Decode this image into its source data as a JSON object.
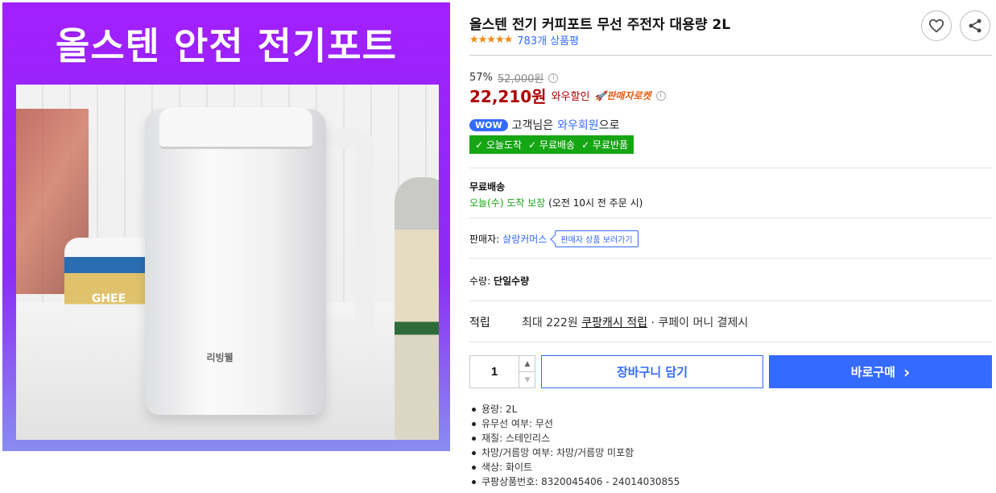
{
  "hero": {
    "title": "올스텐 안전 전기포트",
    "kettle_brand": "리빙웰",
    "jar_label": "GHEE"
  },
  "product": {
    "title": "올스텐 전기 커피포트 무선 주전자 대용량 2L",
    "stars": "★★★★★",
    "review_count": "783개 상품평",
    "rating_value": 4.5
  },
  "price": {
    "discount_rate": "57%",
    "original": "52,000원",
    "sale": "22,210원",
    "wow_label": "와우할인",
    "rocket_label": "판매자로켓"
  },
  "wow": {
    "badge": "WOW",
    "text_before": "고객님은",
    "member": "와우회원",
    "text_after": "으로",
    "benefits": [
      "✓ 오늘도착",
      "✓ 무료배송",
      "✓ 무료반품"
    ]
  },
  "shipping": {
    "label": "무료배송",
    "arrival": "오늘(수)",
    "guarantee": "도착 보장",
    "note": "(오전 10시 전 주문 시)"
  },
  "seller": {
    "prefix": "판매자:",
    "name": "살랑커머스",
    "button": "판매자 상품 보러가기"
  },
  "option": {
    "label": "수량:",
    "value": "단일수량"
  },
  "points": {
    "label": "적립",
    "prefix": "최대 222원",
    "link": "쿠팡캐시 적립",
    "suffix": "· 쿠페이 머니 결제시"
  },
  "purchase": {
    "quantity": "1",
    "up": "▲",
    "down": "▼",
    "cart_label": "장바구니 담기",
    "buy_label": "바로구매",
    "buy_arrow": "›"
  },
  "specs": [
    "용량: 2L",
    "유무선 여부: 무선",
    "재질: 스테인리스",
    "차망/거름망 여부: 차망/거름망 미포함",
    "색상: 화이트",
    "쿠팡상품번호: 8320045406 - 24014030855"
  ],
  "colors": {
    "accent": "#346aff",
    "price": "#ae0000",
    "green": "#15a614",
    "hero_purple": "#a21fff"
  }
}
